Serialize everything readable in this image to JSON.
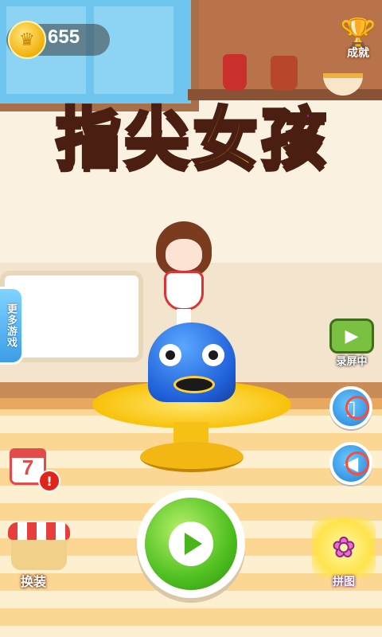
{
  "coins": {
    "icon": "crown-coin-icon",
    "count": "655"
  },
  "achievement": {
    "icon": "trophy-icon",
    "label": "成就"
  },
  "title": {
    "chars": [
      "指",
      "尖",
      "女",
      "孩"
    ],
    "colors": [
      "#ff3b3b",
      "#29b7f4",
      "#ffcc1a",
      "#d92fe0"
    ]
  },
  "side_menu": {
    "more_games_label": "更多游戏"
  },
  "record": {
    "icon": "record-camera-icon",
    "label": "录屏中"
  },
  "vibrate": {
    "icon": "vibrate-off-icon"
  },
  "sound": {
    "icon": "sound-off-icon"
  },
  "daily": {
    "icon": "calendar-icon",
    "day": "7",
    "badge": "!"
  },
  "dress_up": {
    "icon": "shop-icon",
    "label": "换装"
  },
  "play": {
    "icon": "play-icon"
  },
  "puzzle": {
    "icon": "puzzle-icon",
    "label": "拼图"
  }
}
